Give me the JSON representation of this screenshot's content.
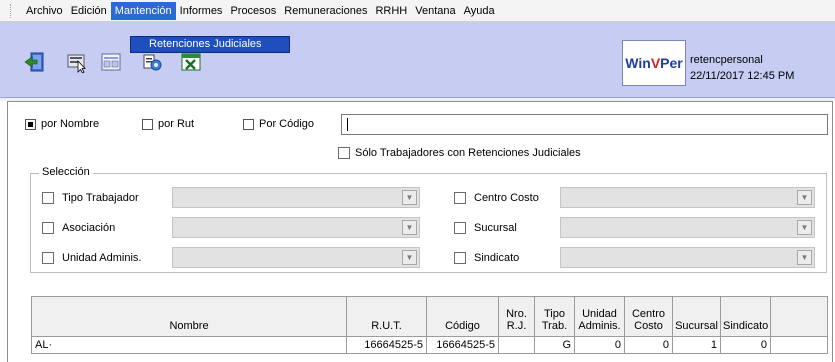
{
  "menu": {
    "items": [
      "Archivo",
      "Edición",
      "Mantención",
      "Informes",
      "Procesos",
      "Remuneraciones",
      "RRHH",
      "Ventana",
      "Ayuda"
    ],
    "active_index": 2,
    "dropdown_item": "Retenciones Judiciales"
  },
  "toolbar": {
    "icons": [
      "exit-icon",
      "select-icon",
      "report-icon",
      "tools-icon",
      "excel-icon"
    ]
  },
  "brand": {
    "logo_w": "Win",
    "logo_v": "V",
    "logo_p": "Per",
    "user": "retencpersonal",
    "datetime": "22/11/2017 12:45 PM"
  },
  "search": {
    "radio_nombre": "por Nombre",
    "radio_rut": "por Rut",
    "radio_codigo": "Por Código",
    "input_value": "",
    "only_retenciones_label": "Sólo Trabajadores con Retenciones Judiciales"
  },
  "selection": {
    "legend": "Selección",
    "left": [
      "Tipo Trabajador",
      "Asociación",
      "Unidad Adminis."
    ],
    "right": [
      "Centro Costo",
      "Sucursal",
      "Sindicato"
    ]
  },
  "table": {
    "headers": [
      "Nombre",
      "R.U.T.",
      "Código",
      "Nro.\nR.J.",
      "Tipo\nTrab.",
      "Unidad\nAdminis.",
      "Centro\nCosto",
      "Sucursal",
      "Sindicato",
      ""
    ],
    "rows": [
      [
        "AL·",
        "16664525-5",
        "16664525-5",
        "",
        "G",
        "0",
        "0",
        "1",
        "0",
        ""
      ]
    ]
  },
  "colors": {
    "toolbar_bg": "#c6ccf2",
    "menu_active": "#2a6ad3"
  }
}
